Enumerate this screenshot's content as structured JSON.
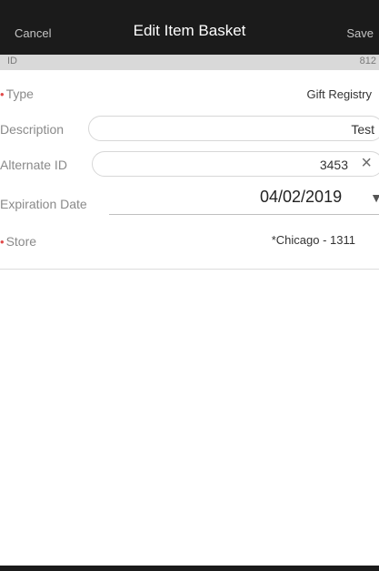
{
  "nav": {
    "cancel_label": "Cancel",
    "title": "Edit Item Basket",
    "save_label": "Save"
  },
  "id_row": {
    "label": "ID",
    "value": "812"
  },
  "form": {
    "type": {
      "label": "Type",
      "value": "Gift Registry",
      "required": true
    },
    "description": {
      "label": "Description",
      "value": "Test"
    },
    "alternate_id": {
      "label": "Alternate ID",
      "value": "3453",
      "clear_icon": "×"
    },
    "expiration_date": {
      "label": "Expiration Date",
      "value": "04/02/2019",
      "dropdown_icon": "▼"
    },
    "store": {
      "label": "Store",
      "value": "*Chicago - 1311",
      "required": true
    }
  },
  "colors": {
    "nav_background": "#1b1b1b",
    "required_marker": "#e14b4b"
  }
}
